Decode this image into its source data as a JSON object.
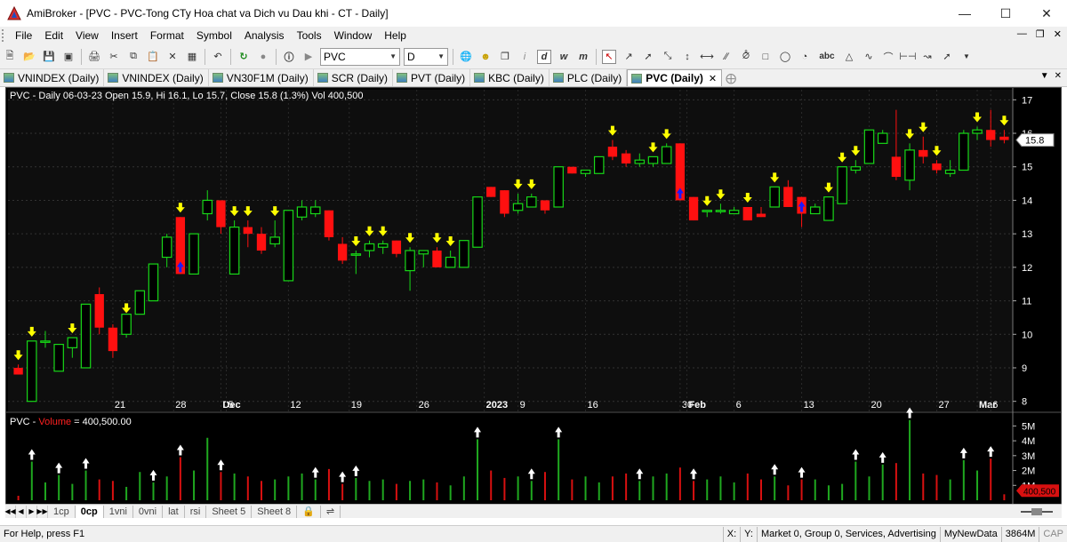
{
  "window": {
    "title": "AmiBroker - [PVC - PVC-Tong CTy Hoa chat va Dich vu Dau khi - CT - Daily]"
  },
  "menu": [
    "File",
    "Edit",
    "View",
    "Insert",
    "Format",
    "Symbol",
    "Analysis",
    "Tools",
    "Window",
    "Help"
  ],
  "toolbar": {
    "symbol_value": "PVC",
    "interval_value": "D",
    "interval_buttons": [
      "i",
      "d",
      "w",
      "m"
    ],
    "text_tool_label": "abc"
  },
  "tabs": [
    {
      "label": "VNINDEX (Daily)",
      "active": false
    },
    {
      "label": "VNINDEX (Daily)",
      "active": false
    },
    {
      "label": "VN30F1M (Daily)",
      "active": false
    },
    {
      "label": "SCR (Daily)",
      "active": false
    },
    {
      "label": "PVT (Daily)",
      "active": false
    },
    {
      "label": "KBC (Daily)",
      "active": false
    },
    {
      "label": "PLC (Daily)",
      "active": false
    },
    {
      "label": "PVC (Daily)",
      "active": true
    }
  ],
  "price_pane": {
    "header": "PVC - Daily 06-03-23 Open 15.9, Hi 16.1, Lo 15.7, Close 15.8 (1.3%) Vol 400,500",
    "y_ticks": [
      17,
      16,
      15,
      14,
      13,
      12,
      11,
      10,
      9,
      8
    ],
    "last_price_label": "15.8",
    "x_labels": [
      "21",
      "28",
      "Dec",
      "5",
      "12",
      "19",
      "26",
      "2023",
      "9",
      "16",
      "30",
      "Feb",
      "6",
      "13",
      "20",
      "27",
      "Mar",
      "6"
    ]
  },
  "volume_pane": {
    "header_prefix": "PVC - ",
    "header_name": "Volume",
    "header_suffix": " = 400,500.00",
    "y_ticks": [
      "5M",
      "4M",
      "3M",
      "2M",
      "1M"
    ],
    "last_volume_label": "400,500"
  },
  "colors": {
    "up": "#18d818",
    "down": "#ff1010",
    "signal_sell": "#ffff00",
    "signal_buy": "#1a1aff",
    "volume_up": "#1fa81f",
    "volume_down": "#d81010"
  },
  "chart_data": {
    "type": "candlestick",
    "ylim": [
      7.7,
      17.3
    ],
    "candles": [
      {
        "o": 9.0,
        "h": 9.1,
        "l": 8.8,
        "c": 8.8
      },
      {
        "o": 8.0,
        "h": 9.8,
        "l": 8.0,
        "c": 9.8
      },
      {
        "o": 9.8,
        "h": 10.1,
        "l": 9.6,
        "c": 9.8
      },
      {
        "o": 8.9,
        "h": 9.7,
        "l": 8.9,
        "c": 9.7
      },
      {
        "o": 9.6,
        "h": 9.9,
        "l": 9.3,
        "c": 9.9
      },
      {
        "o": 9.0,
        "h": 10.9,
        "l": 9.0,
        "c": 10.9
      },
      {
        "o": 11.2,
        "h": 11.4,
        "l": 10.0,
        "c": 10.2
      },
      {
        "o": 10.2,
        "h": 10.3,
        "l": 9.3,
        "c": 9.5
      },
      {
        "o": 10.0,
        "h": 10.5,
        "l": 9.9,
        "c": 10.6
      },
      {
        "o": 10.6,
        "h": 11.3,
        "l": 10.6,
        "c": 11.3
      },
      {
        "o": 11.0,
        "h": 12.1,
        "l": 11.0,
        "c": 12.1
      },
      {
        "o": 12.3,
        "h": 13.0,
        "l": 12.0,
        "c": 12.9
      },
      {
        "o": 13.5,
        "h": 13.5,
        "l": 11.8,
        "c": 11.8
      },
      {
        "o": 11.8,
        "h": 13.0,
        "l": 11.8,
        "c": 13.0
      },
      {
        "o": 13.6,
        "h": 14.3,
        "l": 13.4,
        "c": 14.0
      },
      {
        "o": 14.0,
        "h": 14.0,
        "l": 13.0,
        "c": 13.2
      },
      {
        "o": 11.8,
        "h": 13.4,
        "l": 11.8,
        "c": 13.2
      },
      {
        "o": 13.2,
        "h": 13.4,
        "l": 12.6,
        "c": 13.0
      },
      {
        "o": 13.0,
        "h": 13.2,
        "l": 12.4,
        "c": 12.5
      },
      {
        "o": 12.7,
        "h": 13.4,
        "l": 12.6,
        "c": 12.9
      },
      {
        "o": 11.6,
        "h": 13.7,
        "l": 11.6,
        "c": 13.7
      },
      {
        "o": 13.5,
        "h": 14.0,
        "l": 13.4,
        "c": 13.8
      },
      {
        "o": 13.6,
        "h": 14.0,
        "l": 13.5,
        "c": 13.8
      },
      {
        "o": 13.7,
        "h": 13.7,
        "l": 12.8,
        "c": 12.9
      },
      {
        "o": 12.7,
        "h": 12.9,
        "l": 12.1,
        "c": 12.2
      },
      {
        "o": 12.4,
        "h": 12.5,
        "l": 11.8,
        "c": 12.4
      },
      {
        "o": 12.5,
        "h": 12.8,
        "l": 12.3,
        "c": 12.7
      },
      {
        "o": 12.6,
        "h": 12.8,
        "l": 12.4,
        "c": 12.7
      },
      {
        "o": 12.8,
        "h": 12.8,
        "l": 12.3,
        "c": 12.4
      },
      {
        "o": 11.9,
        "h": 12.6,
        "l": 11.3,
        "c": 12.5
      },
      {
        "o": 12.4,
        "h": 12.5,
        "l": 12.0,
        "c": 12.5
      },
      {
        "o": 12.5,
        "h": 12.6,
        "l": 12.0,
        "c": 12.0
      },
      {
        "o": 12.0,
        "h": 12.5,
        "l": 12.0,
        "c": 12.3
      },
      {
        "o": 12.0,
        "h": 12.8,
        "l": 12.0,
        "c": 12.8
      },
      {
        "o": 12.6,
        "h": 14.1,
        "l": 12.6,
        "c": 14.1
      },
      {
        "o": 14.4,
        "h": 14.4,
        "l": 14.1,
        "c": 14.1
      },
      {
        "o": 14.3,
        "h": 14.3,
        "l": 13.5,
        "c": 13.6
      },
      {
        "o": 13.7,
        "h": 14.2,
        "l": 13.6,
        "c": 13.9
      },
      {
        "o": 13.8,
        "h": 14.2,
        "l": 13.8,
        "c": 14.1
      },
      {
        "o": 14.0,
        "h": 14.0,
        "l": 13.6,
        "c": 13.7
      },
      {
        "o": 13.8,
        "h": 15.0,
        "l": 13.8,
        "c": 15.0
      },
      {
        "o": 15.0,
        "h": 15.0,
        "l": 14.8,
        "c": 14.8
      },
      {
        "o": 14.8,
        "h": 14.9,
        "l": 14.7,
        "c": 14.9
      },
      {
        "o": 14.8,
        "h": 15.3,
        "l": 14.8,
        "c": 15.3
      },
      {
        "o": 15.6,
        "h": 15.8,
        "l": 15.2,
        "c": 15.3
      },
      {
        "o": 15.4,
        "h": 15.5,
        "l": 15.0,
        "c": 15.1
      },
      {
        "o": 15.1,
        "h": 15.4,
        "l": 15.0,
        "c": 15.2
      },
      {
        "o": 15.1,
        "h": 15.3,
        "l": 15.0,
        "c": 15.3
      },
      {
        "o": 15.1,
        "h": 15.7,
        "l": 15.1,
        "c": 15.6
      },
      {
        "o": 15.7,
        "h": 15.7,
        "l": 14.0,
        "c": 14.0
      },
      {
        "o": 14.1,
        "h": 14.1,
        "l": 13.4,
        "c": 13.4
      },
      {
        "o": 13.7,
        "h": 13.7,
        "l": 13.5,
        "c": 13.7
      },
      {
        "o": 13.7,
        "h": 13.9,
        "l": 13.6,
        "c": 13.7
      },
      {
        "o": 13.6,
        "h": 13.8,
        "l": 13.6,
        "c": 13.7
      },
      {
        "o": 13.8,
        "h": 13.8,
        "l": 13.4,
        "c": 13.4
      },
      {
        "o": 13.6,
        "h": 13.8,
        "l": 13.5,
        "c": 13.5
      },
      {
        "o": 13.8,
        "h": 14.4,
        "l": 13.8,
        "c": 14.4
      },
      {
        "o": 14.4,
        "h": 14.6,
        "l": 13.8,
        "c": 13.8
      },
      {
        "o": 14.1,
        "h": 14.1,
        "l": 13.2,
        "c": 13.6
      },
      {
        "o": 13.6,
        "h": 13.9,
        "l": 13.6,
        "c": 13.8
      },
      {
        "o": 13.4,
        "h": 14.1,
        "l": 13.4,
        "c": 14.1
      },
      {
        "o": 13.9,
        "h": 15.0,
        "l": 13.9,
        "c": 15.0
      },
      {
        "o": 14.9,
        "h": 15.2,
        "l": 14.8,
        "c": 15.0
      },
      {
        "o": 15.1,
        "h": 16.1,
        "l": 15.1,
        "c": 16.1
      },
      {
        "o": 15.7,
        "h": 16.1,
        "l": 15.7,
        "c": 16.0
      },
      {
        "o": 15.3,
        "h": 16.7,
        "l": 14.6,
        "c": 14.7
      },
      {
        "o": 14.6,
        "h": 15.7,
        "l": 14.3,
        "c": 15.5
      },
      {
        "o": 15.5,
        "h": 15.9,
        "l": 15.1,
        "c": 15.3
      },
      {
        "o": 15.1,
        "h": 15.2,
        "l": 14.8,
        "c": 14.9
      },
      {
        "o": 14.8,
        "h": 15.2,
        "l": 14.7,
        "c": 14.9
      },
      {
        "o": 14.9,
        "h": 16.1,
        "l": 14.9,
        "c": 16.0
      },
      {
        "o": 16.0,
        "h": 16.2,
        "l": 15.8,
        "c": 16.1
      },
      {
        "o": 16.1,
        "h": 16.7,
        "l": 15.6,
        "c": 15.8
      },
      {
        "o": 15.9,
        "h": 16.1,
        "l": 15.7,
        "c": 15.8
      }
    ],
    "volume_ylim": [
      0,
      5.5
    ],
    "volumes": [
      0.3,
      2.6,
      1.2,
      1.7,
      1.1,
      2.0,
      1.4,
      1.3,
      0.9,
      1.9,
      1.2,
      1.6,
      2.9,
      2.0,
      4.2,
      1.9,
      1.8,
      1.6,
      1.3,
      1.4,
      1.6,
      1.8,
      1.4,
      2.1,
      1.1,
      1.5,
      1.3,
      1.4,
      1.1,
      1.3,
      1.4,
      1.2,
      1.0,
      1.6,
      4.1,
      2.0,
      1.5,
      1.6,
      1.3,
      1.9,
      4.1,
      1.4,
      1.6,
      1.2,
      1.6,
      1.8,
      1.3,
      1.6,
      1.8,
      2.2,
      1.3,
      1.4,
      1.6,
      1.2,
      1.8,
      1.4,
      1.6,
      1.0,
      1.4,
      1.4,
      1.0,
      1.1,
      2.6,
      1.6,
      2.4,
      2.5,
      5.4,
      1.8,
      1.7,
      1.4,
      2.7,
      2.0,
      2.8,
      0.4
    ],
    "sell_signals": [
      0,
      1,
      4,
      8,
      12,
      16,
      17,
      19,
      25,
      26,
      27,
      29,
      31,
      32,
      37,
      38,
      44,
      47,
      48,
      51,
      52,
      54,
      56,
      60,
      61,
      62,
      66,
      67,
      68,
      71,
      73
    ],
    "buy_signals": [
      12,
      49,
      58
    ],
    "volume_up_arrows": [
      1,
      3,
      5,
      10,
      12,
      15,
      22,
      24,
      25,
      34,
      38,
      40,
      46,
      50,
      56,
      58,
      62,
      64,
      66,
      70,
      72
    ]
  }
}
